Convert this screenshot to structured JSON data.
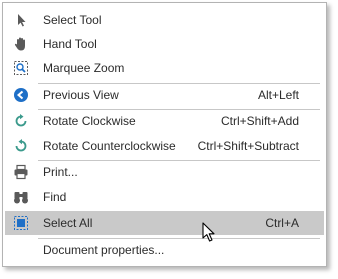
{
  "colors": {
    "icon_gray": "#5a5a5a",
    "icon_blue": "#1e6fc7",
    "icon_green": "#3b9a8c",
    "selected_bg": "#c9c9c9",
    "text": "#2b2b2b"
  },
  "menu": {
    "items": [
      {
        "label": "Select Tool",
        "shortcut": "",
        "icon": "cursor-arrow-icon"
      },
      {
        "label": "Hand Tool",
        "shortcut": "",
        "icon": "hand-icon"
      },
      {
        "label": "Marquee Zoom",
        "shortcut": "",
        "icon": "marquee-zoom-icon"
      },
      {
        "label": "Previous View",
        "shortcut": "Alt+Left",
        "icon": "back-arrow-icon"
      },
      {
        "label": "Rotate Clockwise",
        "shortcut": "Ctrl+Shift+Add",
        "icon": "rotate-clockwise-icon"
      },
      {
        "label": "Rotate Counterclockwise",
        "shortcut": "Ctrl+Shift+Subtract",
        "icon": "rotate-counterclockwise-icon"
      },
      {
        "label": "Print...",
        "shortcut": "",
        "icon": "printer-icon"
      },
      {
        "label": "Find",
        "shortcut": "",
        "icon": "binoculars-icon"
      },
      {
        "label": "Select All",
        "shortcut": "Ctrl+A",
        "icon": "select-all-icon",
        "selected": true
      },
      {
        "label": "Document properties...",
        "shortcut": "",
        "icon": ""
      }
    ]
  }
}
